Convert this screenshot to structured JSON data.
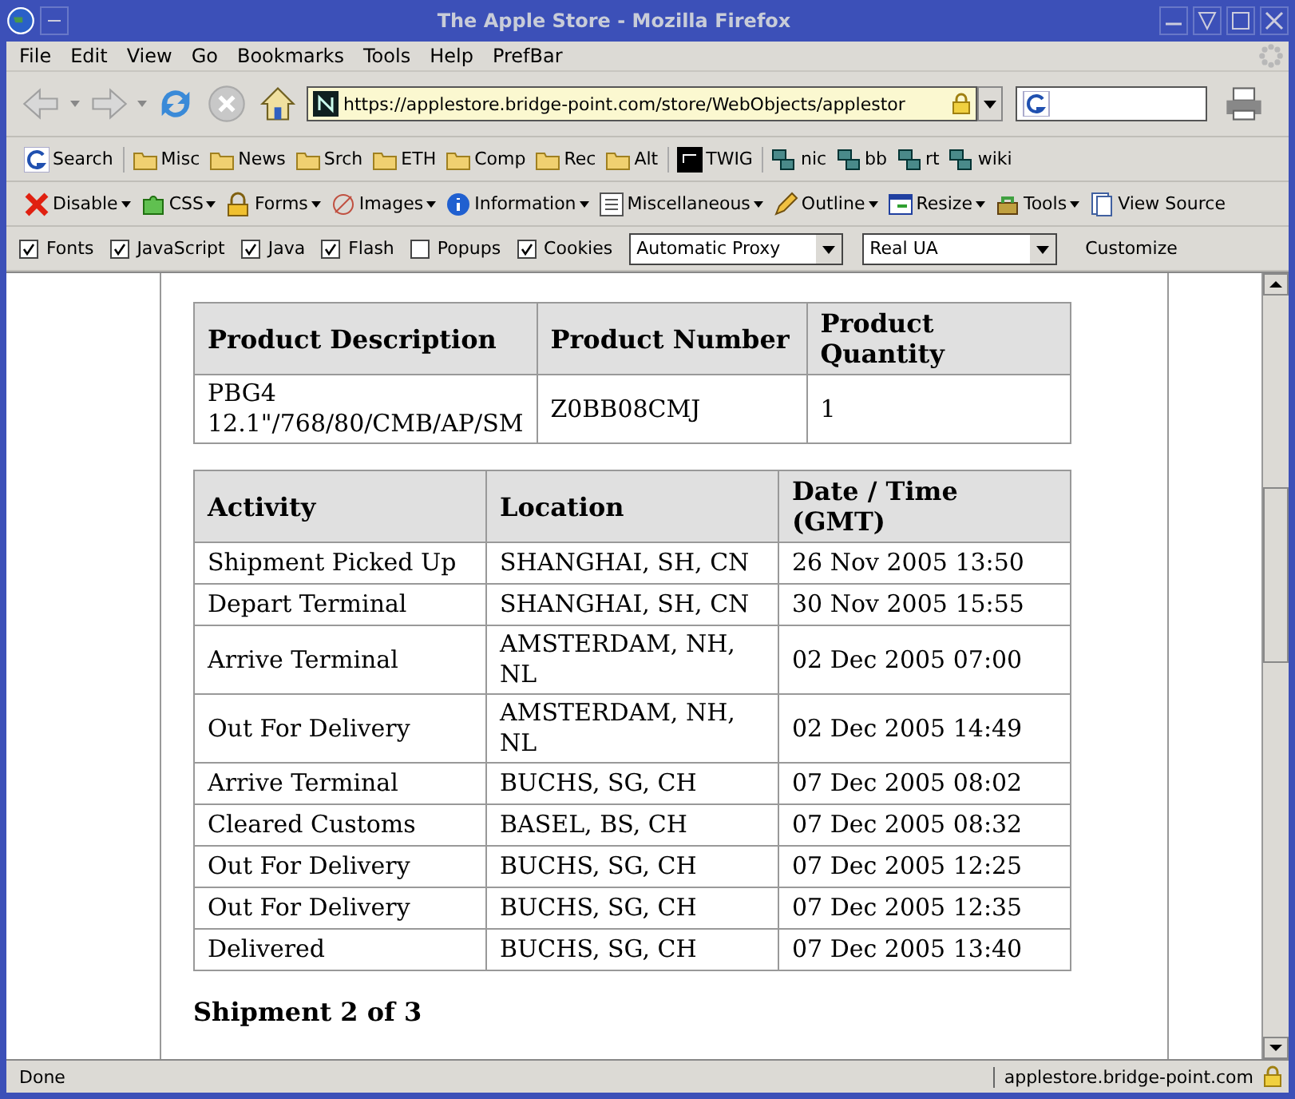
{
  "window": {
    "title": "The Apple Store - Mozilla Firefox"
  },
  "menu": [
    "File",
    "Edit",
    "View",
    "Go",
    "Bookmarks",
    "Tools",
    "Help",
    "PrefBar"
  ],
  "address": {
    "value": "https://applestore.bridge-point.com/store/WebObjects/applestor"
  },
  "bookmarks": [
    {
      "label": "Search",
      "kind": "google"
    },
    {
      "label": "Misc",
      "kind": "folder"
    },
    {
      "label": "News",
      "kind": "folder"
    },
    {
      "label": "Srch",
      "kind": "folder"
    },
    {
      "label": "ETH",
      "kind": "folder"
    },
    {
      "label": "Comp",
      "kind": "folder"
    },
    {
      "label": "Rec",
      "kind": "folder"
    },
    {
      "label": "Alt",
      "kind": "folder"
    },
    {
      "label": "TWIG",
      "kind": "twig"
    },
    {
      "label": "nic",
      "kind": "net"
    },
    {
      "label": "bb",
      "kind": "net"
    },
    {
      "label": "rt",
      "kind": "net"
    },
    {
      "label": "wiki",
      "kind": "net"
    }
  ],
  "dev_toolbar": [
    {
      "label": "Disable",
      "kind": "cross",
      "dropdown": true
    },
    {
      "label": "CSS",
      "kind": "puzzle",
      "dropdown": true
    },
    {
      "label": "Forms",
      "kind": "lock",
      "dropdown": true
    },
    {
      "label": "Images",
      "kind": "image",
      "dropdown": true
    },
    {
      "label": "Information",
      "kind": "info",
      "dropdown": true
    },
    {
      "label": "Miscellaneous",
      "kind": "list",
      "dropdown": true
    },
    {
      "label": "Outline",
      "kind": "pencil",
      "dropdown": true
    },
    {
      "label": "Resize",
      "kind": "window",
      "dropdown": true
    },
    {
      "label": "Tools",
      "kind": "tools",
      "dropdown": true
    },
    {
      "label": "View Source",
      "kind": "doc",
      "dropdown": false
    }
  ],
  "prefbar": {
    "checks": [
      {
        "label": "Fonts",
        "checked": true
      },
      {
        "label": "JavaScript",
        "checked": true
      },
      {
        "label": "Java",
        "checked": true
      },
      {
        "label": "Flash",
        "checked": true
      },
      {
        "label": "Popups",
        "checked": false
      },
      {
        "label": "Cookies",
        "checked": true
      }
    ],
    "proxy": "Automatic Proxy",
    "user_agent": "Real UA",
    "customize": "Customize"
  },
  "product_table": {
    "columns": [
      "Product Description",
      "Product Number",
      "Product Quantity"
    ],
    "rows": [
      [
        "PBG4 12.1\"/768/80/CMB/AP/SM",
        "Z0BB08CMJ",
        "1"
      ]
    ]
  },
  "activity_table": {
    "columns": [
      "Activity",
      "Location",
      "Date / Time (GMT)"
    ],
    "rows": [
      [
        "Shipment Picked Up",
        "SHANGHAI, SH, CN",
        "26 Nov 2005 13:50"
      ],
      [
        "Depart Terminal",
        "SHANGHAI, SH, CN",
        "30 Nov 2005 15:55"
      ],
      [
        "Arrive Terminal",
        "AMSTERDAM, NH, NL",
        "02 Dec 2005 07:00"
      ],
      [
        "Out For Delivery",
        "AMSTERDAM, NH, NL",
        "02 Dec 2005 14:49"
      ],
      [
        "Arrive Terminal",
        "BUCHS, SG, CH",
        "07 Dec 2005 08:02"
      ],
      [
        "Cleared Customs",
        "BASEL, BS, CH",
        "07 Dec 2005 08:32"
      ],
      [
        "Out For Delivery",
        "BUCHS, SG, CH",
        "07 Dec 2005 12:25"
      ],
      [
        "Out For Delivery",
        "BUCHS, SG, CH",
        "07 Dec 2005 12:35"
      ],
      [
        "Delivered",
        "BUCHS, SG, CH",
        "07 Dec 2005 13:40"
      ]
    ]
  },
  "section_heading": "Shipment 2 of 3",
  "status_bar": {
    "text": "Done",
    "host": "applestore.bridge-point.com"
  }
}
